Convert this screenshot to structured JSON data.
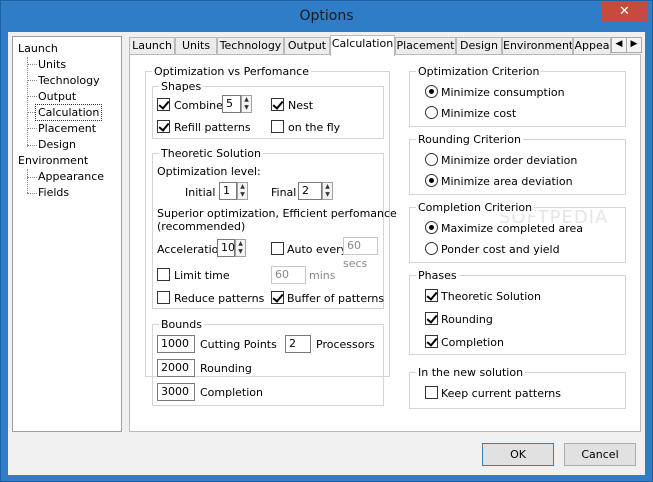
{
  "window": {
    "title": "Options",
    "close_glyph": "✕"
  },
  "tree": {
    "items": [
      {
        "label": "Launch"
      },
      {
        "label": "Units"
      },
      {
        "label": "Technology"
      },
      {
        "label": "Output"
      },
      {
        "label": "Calculation"
      },
      {
        "label": "Placement"
      },
      {
        "label": "Design"
      },
      {
        "label": "Environment"
      },
      {
        "label": "Appearance"
      },
      {
        "label": "Fields"
      }
    ]
  },
  "tabs": [
    {
      "label": "Launch"
    },
    {
      "label": "Units"
    },
    {
      "label": "Technology"
    },
    {
      "label": "Output"
    },
    {
      "label": "Calculation"
    },
    {
      "label": "Placement"
    },
    {
      "label": "Design"
    },
    {
      "label": "Environment"
    },
    {
      "label": "Appea"
    }
  ],
  "tab_scroll": {
    "left": "◀",
    "right": "▶"
  },
  "opt_perf": {
    "title": "Optimization vs Perfomance",
    "shapes": {
      "title": "Shapes",
      "combine": "Combine",
      "combine_value": "5",
      "nest": "Nest",
      "refill": "Refill patterns",
      "on_the_fly": "on the fly"
    },
    "theoretic": {
      "title": "Theoretic Solution",
      "level_label": "Optimization level:",
      "initial_label": "Initial",
      "initial_value": "1",
      "final_label": "Final",
      "final_value": "2",
      "desc": "Superior optimization, Efficient perfomance",
      "desc2": "(recommended)",
      "accel_label": "Acceleration",
      "accel_value": "10",
      "auto_every": "Auto every",
      "auto_value": "60",
      "auto_unit": "secs",
      "limit_time": "Limit time",
      "limit_value": "60",
      "limit_unit": "mins",
      "reduce": "Reduce patterns",
      "buffer": "Buffer of patterns"
    },
    "bounds": {
      "title": "Bounds",
      "cutting_value": "1000",
      "cutting_label": "Cutting Points",
      "processors_value": "2",
      "processors_label": "Processors",
      "rounding_value": "2000",
      "rounding_label": "Rounding",
      "completion_value": "3000",
      "completion_label": "Completion"
    }
  },
  "opt_criterion": {
    "title": "Optimization Criterion",
    "min_consumption": "Minimize consumption",
    "min_cost": "Minimize cost"
  },
  "rounding_criterion": {
    "title": "Rounding Criterion",
    "min_order": "Minimize order deviation",
    "min_area": "Minimize area deviation"
  },
  "completion_criterion": {
    "title": "Completion Criterion",
    "max_area": "Maximize completed area",
    "ponder": "Ponder cost and yield"
  },
  "phases": {
    "title": "Phases",
    "theoretic": "Theoretic Solution",
    "rounding": "Rounding",
    "completion": "Completion"
  },
  "new_solution": {
    "title": "In the new solution",
    "keep": "Keep current patterns"
  },
  "buttons": {
    "ok": "OK",
    "cancel": "Cancel"
  },
  "watermark": "SOFTPEDIA"
}
